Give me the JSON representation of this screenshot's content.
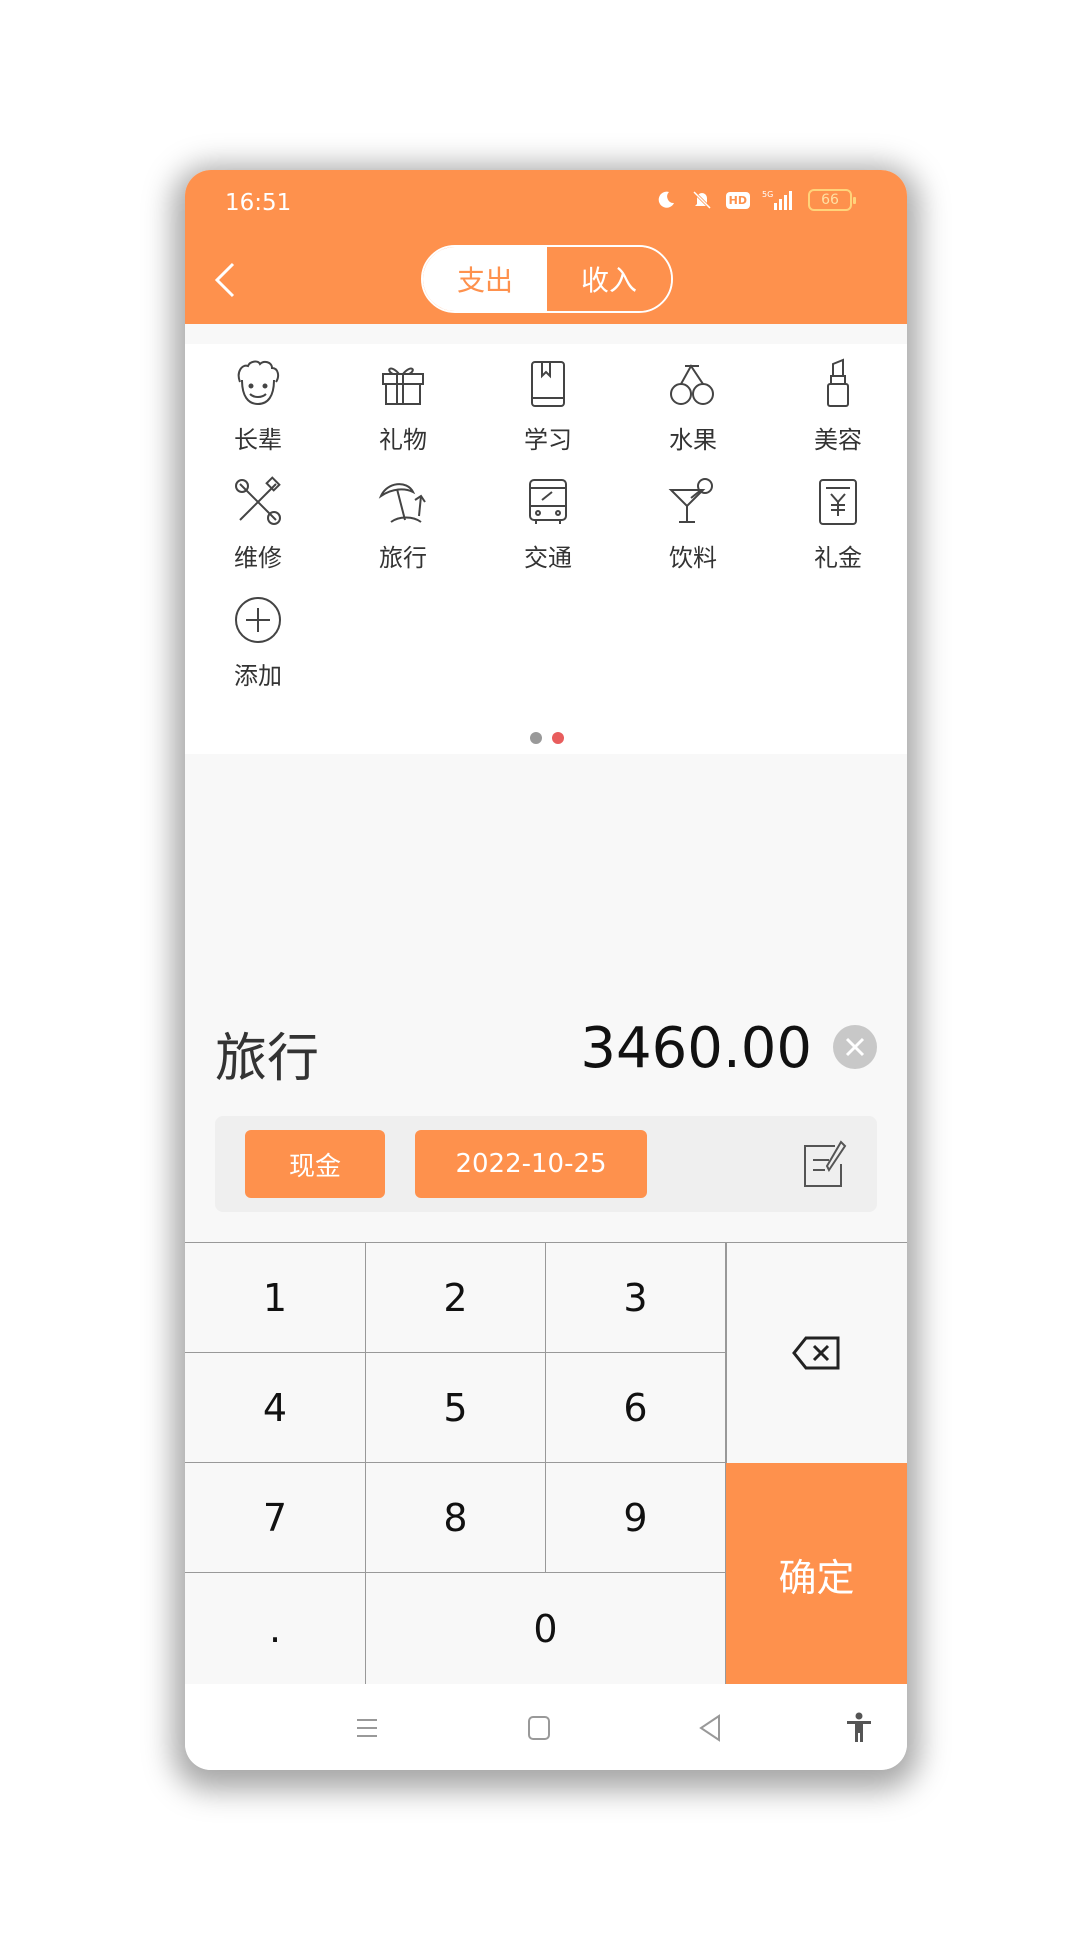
{
  "status_bar": {
    "time": "16:51",
    "hd": "HD",
    "network": "5G",
    "battery": "66"
  },
  "colors": {
    "accent": "#fe914d",
    "dot_inactive": "#999999",
    "dot_active": "#e85d5d"
  },
  "tabs": [
    {
      "label": "支出",
      "active": true
    },
    {
      "label": "收入",
      "active": false
    }
  ],
  "categories": [
    {
      "label": "长辈",
      "icon": "elder-icon"
    },
    {
      "label": "礼物",
      "icon": "gift-icon"
    },
    {
      "label": "学习",
      "icon": "book-icon"
    },
    {
      "label": "水果",
      "icon": "cherry-icon"
    },
    {
      "label": "美容",
      "icon": "lipstick-icon"
    },
    {
      "label": "维修",
      "icon": "tools-icon"
    },
    {
      "label": "旅行",
      "icon": "beach-umbrella-icon"
    },
    {
      "label": "交通",
      "icon": "bus-icon"
    },
    {
      "label": "饮料",
      "icon": "cocktail-icon"
    },
    {
      "label": "礼金",
      "icon": "money-envelope-icon"
    },
    {
      "label": "添加",
      "icon": "add-circle-icon"
    }
  ],
  "entry": {
    "category": "旅行",
    "amount": "3460.00",
    "account": "现金",
    "date": "2022-10-25"
  },
  "keypad": {
    "keys": [
      "1",
      "2",
      "3",
      "4",
      "5",
      "6",
      "7",
      "8",
      "9",
      ".",
      "0"
    ],
    "confirm": "确定"
  }
}
